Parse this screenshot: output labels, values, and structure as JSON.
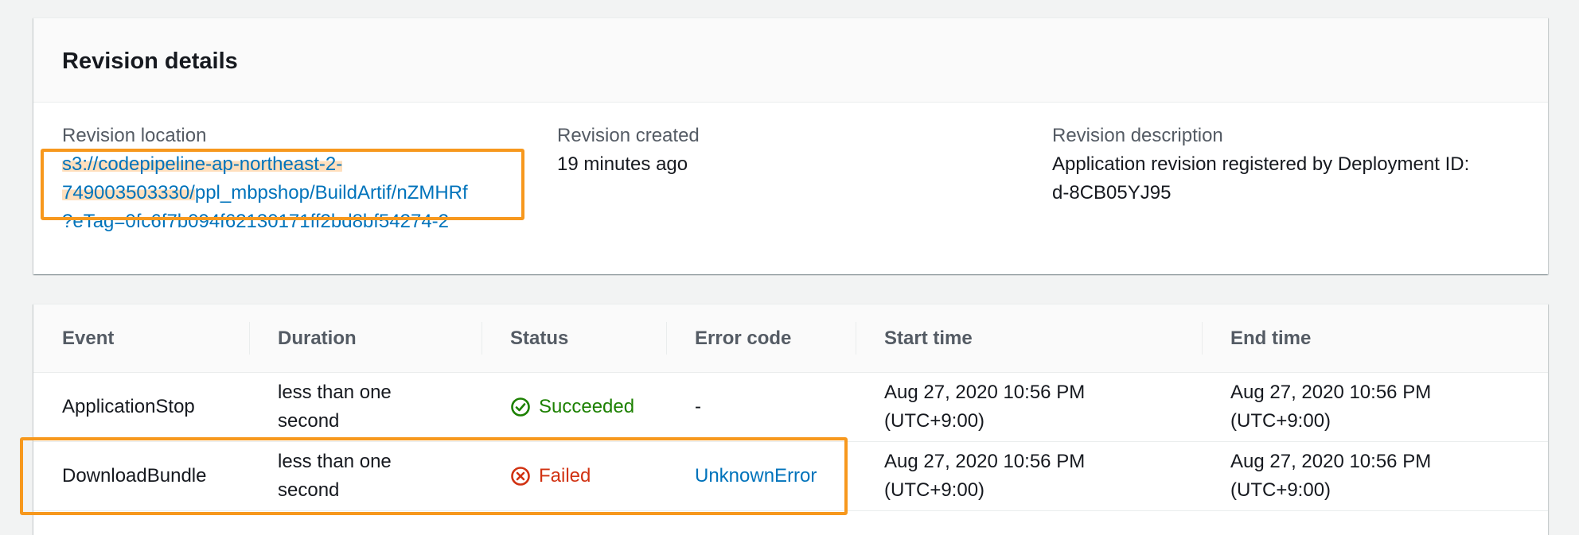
{
  "revision_details": {
    "title": "Revision details",
    "location_label": "Revision location",
    "location_value": "s3://codepipeline-ap-northeast-2-749003503330/ppl_mbpshop/BuildArtif/nZMHRf?eTag=0fc6f7b094f62130171ff2bd8bf54274-2",
    "location_line1": "s3://codepipeline-ap-northeast-2-",
    "location_line2_hl": "749003503330/",
    "location_line2_rest": "ppl_mbpshop/BuildArtif/nZMHRf",
    "location_line3": "?eTag=0fc6f7b094f62130171ff2bd8bf54274-2",
    "created_label": "Revision created",
    "created_value": "19 minutes ago",
    "description_label": "Revision description",
    "description_line1": "Application revision registered by Deployment ID:",
    "description_line2": "d-8CB05YJ95"
  },
  "events_table": {
    "columns": [
      "Event",
      "Duration",
      "Status",
      "Error code",
      "Start time",
      "End time"
    ],
    "rows": [
      {
        "event": "ApplicationStop",
        "duration_line1": "less than one",
        "duration_line2": "second",
        "status": "Succeeded",
        "status_icon": "check-circle-icon",
        "error_code": "-",
        "start_line1": "Aug 27, 2020 10:56 PM",
        "start_line2": "(UTC+9:00)",
        "end_line1": "Aug 27, 2020 10:56 PM",
        "end_line2": "(UTC+9:00)"
      },
      {
        "event": "DownloadBundle",
        "duration_line1": "less than one",
        "duration_line2": "second",
        "status": "Failed",
        "status_icon": "x-circle-icon",
        "error_code": "UnknownError",
        "start_line1": "Aug 27, 2020 10:56 PM",
        "start_line2": "(UTC+9:00)",
        "end_line1": "Aug 27, 2020 10:56 PM",
        "end_line2": "(UTC+9:00)"
      }
    ]
  },
  "colors": {
    "link": "#0073bb",
    "success": "#1d8102",
    "error": "#d13212",
    "highlight_box": "#f7981d",
    "text_secondary": "#545b64"
  }
}
